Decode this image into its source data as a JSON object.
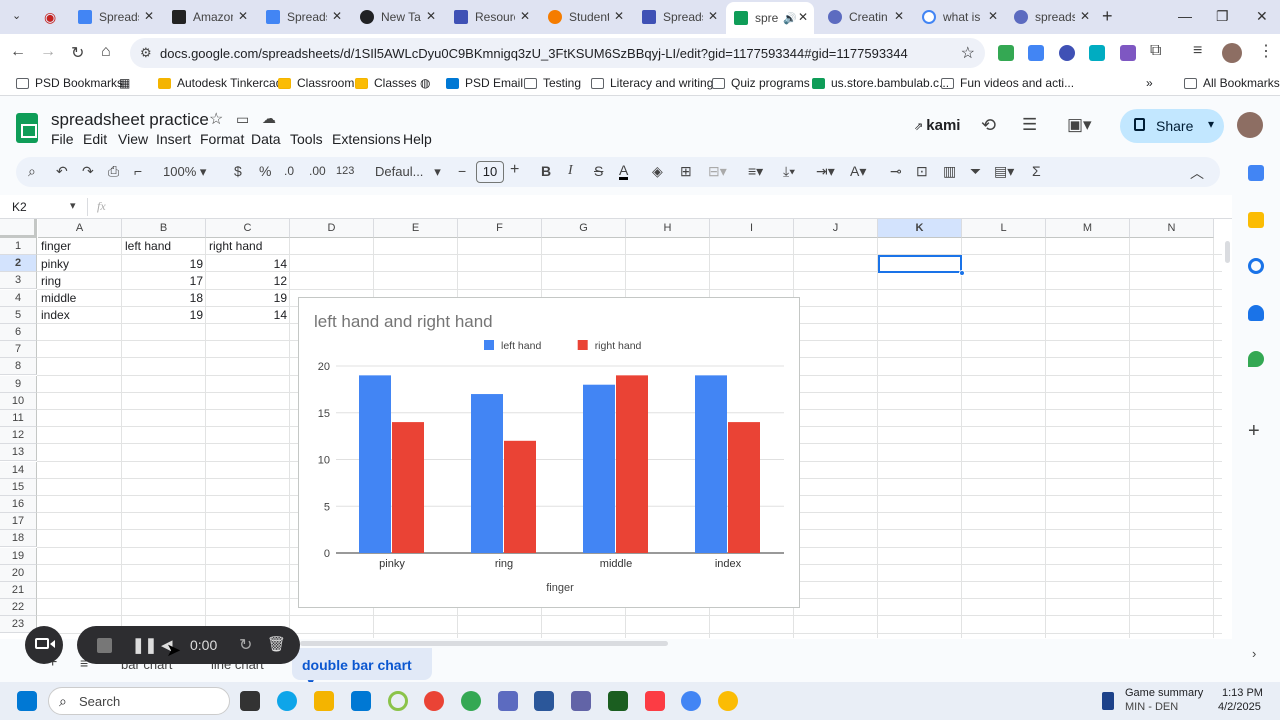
{
  "browser": {
    "tabs": [
      {
        "label": "Spreads",
        "color": "#4285f4"
      },
      {
        "label": "Amazon",
        "color": "#222222"
      },
      {
        "label": "Spreads",
        "color": "#4285f4"
      },
      {
        "label": "New Ta",
        "color": "#202124"
      },
      {
        "label": "Resourc",
        "color": "#3f51b5"
      },
      {
        "label": "Student",
        "color": "#f57c00"
      },
      {
        "label": "Spreads",
        "color": "#3f51b5"
      },
      {
        "label": "spre",
        "color": "#0f9d58"
      },
      {
        "label": "Creatin",
        "color": "#5c6bc0"
      },
      {
        "label": "what is",
        "color": "#4285f4"
      },
      {
        "label": "spreads",
        "color": "#5c6bc0"
      }
    ],
    "url": "docs.google.com/spreadsheets/d/1SIl5AWLcDyu0C9BKmnigq3zU_3FtKSUM6SzBBqyj-LI/edit?gid=1177593344#gid=1177593344",
    "bookmarks": [
      "PSD Bookmarks",
      "Autodesk Tinkercad",
      "Classroom",
      "Classes",
      "PSD Email",
      "Testing",
      "Literacy and writing",
      "Quiz programs",
      "us.store.bambulab.c...",
      "Fun videos and acti..."
    ],
    "all_bookmarks": "All Bookmarks"
  },
  "sheets": {
    "title": "spreadsheet practice",
    "menu": [
      "File",
      "Edit",
      "View",
      "Insert",
      "Format",
      "Data",
      "Tools",
      "Extensions",
      "Help"
    ],
    "kami": "kami",
    "share_label": "Share",
    "toolbar": {
      "zoom": "100%",
      "currency": "$",
      "percent": "%",
      "dec_down": ".0",
      "dec_up": ".00",
      "number_format": "123",
      "font": "Defaul...",
      "font_size": "10",
      "bold": "B",
      "italic": "I",
      "strike": "S",
      "text_color": "A"
    },
    "name_box": "K2",
    "fx": "fx"
  },
  "grid": {
    "columns": [
      "A",
      "B",
      "C",
      "D",
      "E",
      "F",
      "G",
      "H",
      "I",
      "J",
      "K",
      "L",
      "M",
      "N"
    ],
    "rows": [
      "1",
      "2",
      "3",
      "4",
      "5",
      "6",
      "7",
      "8",
      "9",
      "10",
      "11",
      "12",
      "13",
      "14",
      "15",
      "16",
      "17",
      "18",
      "19",
      "20",
      "21",
      "22",
      "23"
    ],
    "header": {
      "a": "finger",
      "b": "left hand",
      "c": "right hand"
    },
    "data": [
      {
        "a": "pinky",
        "b": "19",
        "c": "14"
      },
      {
        "a": "ring",
        "b": "17",
        "c": "12"
      },
      {
        "a": "middle",
        "b": "18",
        "c": "19"
      },
      {
        "a": "index",
        "b": "19",
        "c": "14"
      }
    ]
  },
  "chart_data": {
    "type": "bar",
    "title": "left hand and right hand",
    "xlabel": "finger",
    "ylabel": "",
    "categories": [
      "pinky",
      "ring",
      "middle",
      "index"
    ],
    "series": [
      {
        "name": "left hand",
        "values": [
          19,
          17,
          18,
          19
        ],
        "color": "#4285f4"
      },
      {
        "name": "right hand",
        "values": [
          14,
          12,
          19,
          14
        ],
        "color": "#ea4335"
      }
    ],
    "ylim": [
      0,
      20
    ],
    "yticks": [
      "0",
      "5",
      "10",
      "15",
      "20"
    ],
    "grid": true,
    "legend": "top"
  },
  "sheet_tabs": {
    "tabs": [
      "bar chart",
      "line chart",
      "double bar chart"
    ],
    "active": "double bar chart"
  },
  "recorder": {
    "time": "0:00"
  },
  "taskbar": {
    "search": "Search",
    "news_title": "Game summary",
    "news_sub": "MIN - DEN",
    "time": "1:13 PM",
    "date": "4/2/2025"
  }
}
